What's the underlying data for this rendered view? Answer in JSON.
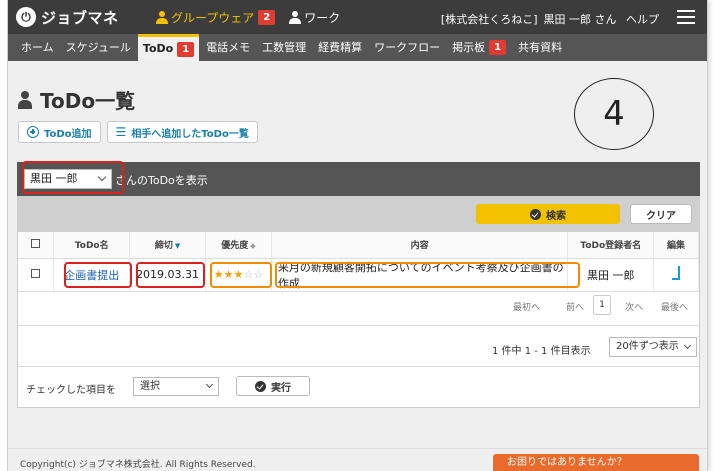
{
  "app": {
    "logo_mark": "⓪",
    "logo_text": "ジョブマネ"
  },
  "top_menu": [
    {
      "label": "グループウェア",
      "badge": "2",
      "active": true
    },
    {
      "label": "ワーク",
      "badge": "",
      "active": false
    }
  ],
  "user": {
    "company": "[株式会社くろねこ]",
    "name": "黒田 一郎 さん",
    "help": "ヘルプ"
  },
  "nav": [
    {
      "label": "ホーム"
    },
    {
      "label": "スケジュール"
    },
    {
      "label": "ToDo",
      "badge": "1",
      "active": true
    },
    {
      "label": "電話メモ"
    },
    {
      "label": "工数管理"
    },
    {
      "label": "経費精算"
    },
    {
      "label": "ワークフロー"
    },
    {
      "label": "掲示板",
      "badge": "1"
    },
    {
      "label": "共有資料"
    }
  ],
  "page": {
    "title": "ToDo一覧"
  },
  "actions": {
    "add": "ToDo追加",
    "assigned": "相手へ追加したToDo一覧"
  },
  "annotation": {
    "number": "4"
  },
  "filter": {
    "selected_user": "黒田 一郎",
    "suffix": "さんのToDoを表示"
  },
  "search": {
    "search_label": "検索",
    "clear_label": "クリア"
  },
  "table": {
    "headers": {
      "name": "ToDo名",
      "deadline": "締切",
      "priority": "優先度",
      "content": "内容",
      "registrant": "ToDo登録者名",
      "edit": "編集"
    },
    "rows": [
      {
        "name": "企画書提出",
        "deadline": "2019.03.31",
        "priority": 3,
        "priority_max": 5,
        "content": "来月の新規顧客開拓についてのイベント考察及び企画書の作成",
        "registrant": "黒田 一郎"
      }
    ]
  },
  "pager": {
    "first": "最初へ",
    "prev": "前へ",
    "current": "1",
    "next": "次へ",
    "last": "最後へ"
  },
  "count": {
    "text": "1 件中 1 - 1 件目表示",
    "per_page": "20件ずつ表示"
  },
  "bulk": {
    "label": "チェックした項目を",
    "select": "選択",
    "exec": "実行"
  },
  "footer": {
    "copyright": "Copyright(c) ジョブマネ株式会社. All Rights Reserved.",
    "help": "お困りではありませんか？"
  },
  "colors": {
    "accent": "#f5c000",
    "badge": "#e03c31",
    "annotation_red": "#d6231d",
    "annotation_orange": "#f08c00",
    "help": "#e86a2c"
  }
}
